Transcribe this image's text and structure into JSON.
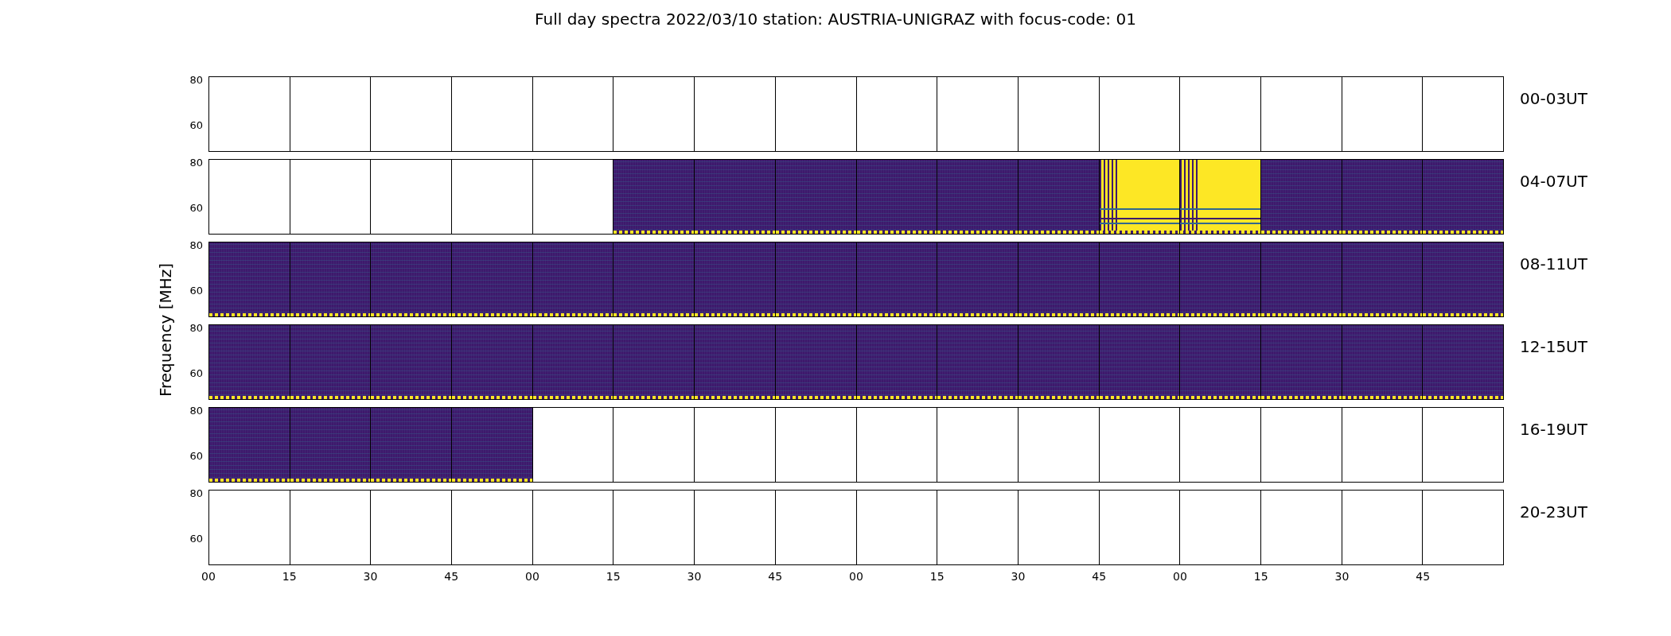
{
  "title": "Full day spectra 2022/03/10 station: AUSTRIA-UNIGRAZ with focus-code: 01",
  "y_axis_label": "Frequency [MHz]",
  "rows": [
    {
      "label": "00-03UT",
      "y_ticks": [
        "80",
        "60"
      ],
      "panels": [
        {
          "kind": "empty"
        },
        {
          "kind": "empty"
        },
        {
          "kind": "empty"
        },
        {
          "kind": "empty"
        },
        {
          "kind": "empty"
        },
        {
          "kind": "empty"
        },
        {
          "kind": "empty"
        },
        {
          "kind": "empty"
        },
        {
          "kind": "empty"
        },
        {
          "kind": "empty"
        },
        {
          "kind": "empty"
        },
        {
          "kind": "empty"
        },
        {
          "kind": "empty"
        },
        {
          "kind": "empty"
        },
        {
          "kind": "empty"
        },
        {
          "kind": "empty"
        }
      ]
    },
    {
      "label": "04-07UT",
      "y_ticks": [
        "80",
        "60"
      ],
      "panels": [
        {
          "kind": "empty"
        },
        {
          "kind": "empty"
        },
        {
          "kind": "empty"
        },
        {
          "kind": "empty"
        },
        {
          "kind": "empty"
        },
        {
          "kind": "spectrum"
        },
        {
          "kind": "spectrum"
        },
        {
          "kind": "spectrum"
        },
        {
          "kind": "spectrum"
        },
        {
          "kind": "spectrum"
        },
        {
          "kind": "spectrum"
        },
        {
          "kind": "saturated"
        },
        {
          "kind": "saturated"
        },
        {
          "kind": "spectrum"
        },
        {
          "kind": "spectrum"
        },
        {
          "kind": "spectrum"
        }
      ]
    },
    {
      "label": "08-11UT",
      "y_ticks": [
        "80",
        "60"
      ],
      "panels": [
        {
          "kind": "spectrum"
        },
        {
          "kind": "spectrum"
        },
        {
          "kind": "spectrum"
        },
        {
          "kind": "spectrum"
        },
        {
          "kind": "spectrum"
        },
        {
          "kind": "spectrum"
        },
        {
          "kind": "spectrum"
        },
        {
          "kind": "spectrum"
        },
        {
          "kind": "spectrum"
        },
        {
          "kind": "spectrum"
        },
        {
          "kind": "spectrum"
        },
        {
          "kind": "spectrum"
        },
        {
          "kind": "spectrum"
        },
        {
          "kind": "spectrum"
        },
        {
          "kind": "spectrum"
        },
        {
          "kind": "spectrum"
        }
      ]
    },
    {
      "label": "12-15UT",
      "y_ticks": [
        "80",
        "60"
      ],
      "panels": [
        {
          "kind": "spectrum"
        },
        {
          "kind": "spectrum"
        },
        {
          "kind": "spectrum"
        },
        {
          "kind": "spectrum"
        },
        {
          "kind": "spectrum"
        },
        {
          "kind": "spectrum"
        },
        {
          "kind": "spectrum"
        },
        {
          "kind": "spectrum"
        },
        {
          "kind": "spectrum"
        },
        {
          "kind": "spectrum"
        },
        {
          "kind": "spectrum"
        },
        {
          "kind": "spectrum"
        },
        {
          "kind": "spectrum"
        },
        {
          "kind": "spectrum"
        },
        {
          "kind": "spectrum"
        },
        {
          "kind": "spectrum"
        }
      ]
    },
    {
      "label": "16-19UT",
      "y_ticks": [
        "80",
        "60"
      ],
      "panels": [
        {
          "kind": "spectrum"
        },
        {
          "kind": "spectrum"
        },
        {
          "kind": "spectrum"
        },
        {
          "kind": "spectrum"
        },
        {
          "kind": "empty"
        },
        {
          "kind": "empty"
        },
        {
          "kind": "empty"
        },
        {
          "kind": "empty"
        },
        {
          "kind": "empty"
        },
        {
          "kind": "empty"
        },
        {
          "kind": "empty"
        },
        {
          "kind": "empty"
        },
        {
          "kind": "empty"
        },
        {
          "kind": "empty"
        },
        {
          "kind": "empty"
        },
        {
          "kind": "empty"
        }
      ]
    },
    {
      "label": "20-23UT",
      "y_ticks": [
        "80",
        "60"
      ],
      "panels": [
        {
          "kind": "empty"
        },
        {
          "kind": "empty"
        },
        {
          "kind": "empty"
        },
        {
          "kind": "empty"
        },
        {
          "kind": "empty"
        },
        {
          "kind": "empty"
        },
        {
          "kind": "empty"
        },
        {
          "kind": "empty"
        },
        {
          "kind": "empty"
        },
        {
          "kind": "empty"
        },
        {
          "kind": "empty"
        },
        {
          "kind": "empty"
        },
        {
          "kind": "empty"
        },
        {
          "kind": "empty"
        },
        {
          "kind": "empty"
        },
        {
          "kind": "empty"
        }
      ]
    }
  ],
  "x_ticks": [
    "00",
    "15",
    "30",
    "45",
    "00",
    "15",
    "30",
    "45",
    "00",
    "15",
    "30",
    "45",
    "00",
    "15",
    "30",
    "45"
  ]
}
